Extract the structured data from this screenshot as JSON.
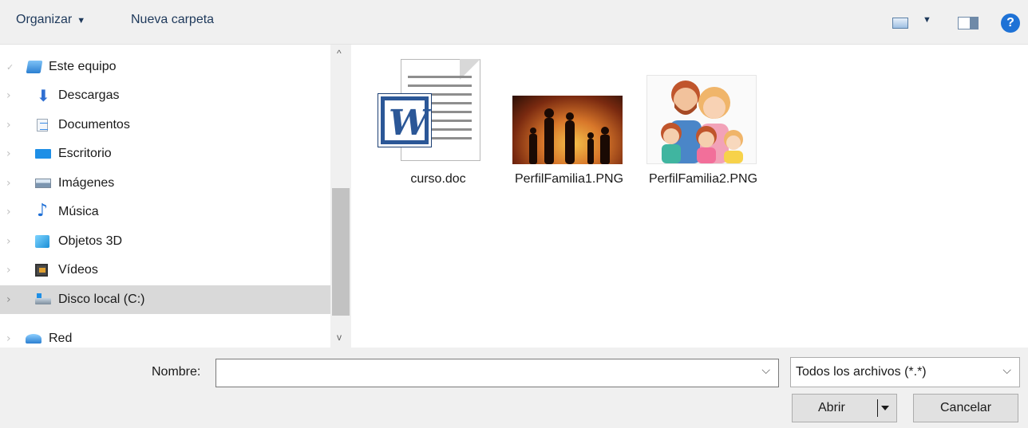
{
  "toolbar": {
    "organize_label": "Organizar",
    "organize_caret": "▼",
    "new_folder_label": "Nueva carpeta",
    "view_caret": "▼",
    "help_glyph": "?"
  },
  "navigation": {
    "items": [
      {
        "label": "Este equipo",
        "icon": "pc-icon"
      },
      {
        "label": "Descargas",
        "icon": "downloads-icon"
      },
      {
        "label": "Documentos",
        "icon": "documents-icon"
      },
      {
        "label": "Escritorio",
        "icon": "desktop-icon"
      },
      {
        "label": "Imágenes",
        "icon": "pictures-icon"
      },
      {
        "label": "Música",
        "icon": "music-icon"
      },
      {
        "label": "Objetos 3D",
        "icon": "3d-objects-icon"
      },
      {
        "label": "Vídeos",
        "icon": "videos-icon"
      },
      {
        "label": "Disco local (C:)",
        "icon": "local-disk-icon",
        "selected": true
      },
      {
        "label": "Red",
        "icon": "network-icon"
      }
    ],
    "scroll_up": "^",
    "scroll_down": "v"
  },
  "files": [
    {
      "name": "curso.doc",
      "icon": "word-document-icon"
    },
    {
      "name": "PerfilFamilia1.PNG",
      "icon": "image-thumbnail"
    },
    {
      "name": "PerfilFamilia2.PNG",
      "icon": "image-thumbnail"
    }
  ],
  "footer": {
    "filename_label": "Nombre:",
    "filename_value": "",
    "filetype_selected": "Todos los archivos (*.*)",
    "open_label": "Abrir",
    "cancel_label": "Cancelar",
    "dropdown_glyph": "⌵"
  },
  "colors": {
    "word_blue": "#2b5797",
    "help_blue": "#1e72d6",
    "selection_gray": "#d9d9d9"
  }
}
